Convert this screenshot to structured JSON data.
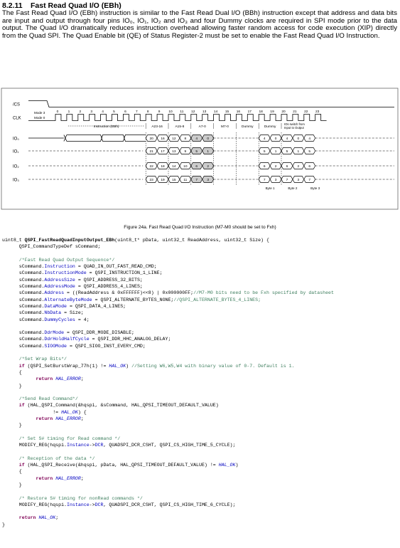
{
  "section": {
    "number": "8.2.11",
    "title": "Fast Read Quad I/O (EBh)"
  },
  "paragraph": "The Fast Read Quad I/O (EBh) instruction is similar to the Fast Read Dual I/O (BBh) instruction except that address and data bits are input and output through four pins IO₀, IO₁, IO₂ and IO₃ and four Dummy clocks are required in SPI mode prior to the data output. The Quad I/O dramatically reduces instruction overhead allowing faster random access for code execution (XIP) directly from the Quad SPI. The Quad Enable bit (QE) of Status Register-2 must be set to enable the Fast Read Quad I/O Instruction.",
  "diagram": {
    "signals": [
      "/CS",
      "CLK",
      "IO₀",
      "IO₁",
      "IO₂",
      "IO₃"
    ],
    "mode_labels": [
      "Mode 3",
      "Mode 0"
    ],
    "clock_numbers": [
      "0",
      "1",
      "2",
      "3",
      "4",
      "5",
      "6",
      "7",
      "8",
      "9",
      "10",
      "11",
      "12",
      "13",
      "14",
      "15",
      "16",
      "17",
      "18",
      "19",
      "20",
      "21",
      "22",
      "23"
    ],
    "phases": [
      "Instruction (EBh)",
      "A23-16",
      "A15-8",
      "A7-0",
      "M7-0",
      "Dummy",
      "Dummy"
    ],
    "switch_note_line1": "IOs switch from",
    "switch_note_line2": "Input to Output",
    "bytes": [
      "Byte 1",
      "Byte 2",
      "Byte 3"
    ],
    "io_bits": [
      [
        "20",
        "16",
        "12",
        "8",
        "4",
        "0"
      ],
      [
        "21",
        "17",
        "13",
        "9",
        "5",
        "1"
      ],
      [
        "22",
        "18",
        "14",
        "10",
        "6",
        "2"
      ],
      [
        "23",
        "19",
        "15",
        "11",
        "7",
        "3"
      ]
    ],
    "io_data": [
      [
        "4",
        "0",
        "4",
        "0",
        "4"
      ],
      [
        "5",
        "1",
        "5",
        "1",
        "5"
      ],
      [
        "6",
        "2",
        "6",
        "2",
        "6"
      ],
      [
        "7",
        "3",
        "7",
        "3",
        "7"
      ]
    ]
  },
  "caption": "Figure 24a. Fast Read Quad I/O Instruction (M7-M0 should be set to Fxh)",
  "code": [
    [
      [
        "t",
        "uint8_t "
      ],
      [
        "b",
        "QSPI_FastReadQuadInputOutput_EBh"
      ],
      [
        "t",
        "(uint8_t* pData, uint32_t ReadAddress, uint32_t Size) {"
      ]
    ],
    [
      [
        "t",
        "      QSPI_CommandTypeDef sCommand;"
      ]
    ],
    [],
    [
      [
        "t",
        "      "
      ],
      [
        "c",
        "/*Fast Read Quad Output Sequence*/"
      ]
    ],
    [
      [
        "t",
        "      sCommand."
      ],
      [
        "f",
        "Instruction"
      ],
      [
        "t",
        " = QUAD_IN_OUT_FAST_READ_CMD;"
      ]
    ],
    [
      [
        "t",
        "      sCommand."
      ],
      [
        "f",
        "InstructionMode"
      ],
      [
        "t",
        " = QSPI_INSTRUCTION_1_LINE;"
      ]
    ],
    [
      [
        "t",
        "      sCommand."
      ],
      [
        "f",
        "AddressSize"
      ],
      [
        "t",
        " = QSPI_ADDRESS_32_BITS;"
      ]
    ],
    [
      [
        "t",
        "      sCommand."
      ],
      [
        "f",
        "AddressMode"
      ],
      [
        "t",
        " = QSPI_ADDRESS_4_LINES;"
      ]
    ],
    [
      [
        "t",
        "      sCommand."
      ],
      [
        "f",
        "Address"
      ],
      [
        "t",
        " = ((ReadAddress & 0xFFFFFF)<<8) | 0x000000FF;"
      ],
      [
        "c",
        "//M7-M0 bits need to be Fxh specified by datasheet"
      ]
    ],
    [
      [
        "t",
        "      sCommand."
      ],
      [
        "f",
        "AlternateByteMode"
      ],
      [
        "t",
        " = QSPI_ALTERNATE_BYTES_NONE;"
      ],
      [
        "c",
        "//QSPI_ALTERNATE_BYTES_4_LINES;"
      ]
    ],
    [
      [
        "t",
        "      sCommand."
      ],
      [
        "f",
        "DataMode"
      ],
      [
        "t",
        " = QSPI_DATA_4_LINES;"
      ]
    ],
    [
      [
        "t",
        "      sCommand."
      ],
      [
        "f",
        "NbData"
      ],
      [
        "t",
        " = Size;"
      ]
    ],
    [
      [
        "t",
        "      sCommand."
      ],
      [
        "f",
        "DummyCycles"
      ],
      [
        "t",
        " = 4;"
      ]
    ],
    [],
    [
      [
        "t",
        "      sCommand."
      ],
      [
        "f",
        "DdrMode"
      ],
      [
        "t",
        " = QSPI_DDR_MODE_DISABLE;"
      ]
    ],
    [
      [
        "t",
        "      sCommand."
      ],
      [
        "f",
        "DdrHoldHalfCycle"
      ],
      [
        "t",
        " = QSPI_DDR_HHC_ANALOG_DELAY;"
      ]
    ],
    [
      [
        "t",
        "      sCommand."
      ],
      [
        "f",
        "SIOOMode"
      ],
      [
        "t",
        " = QSPI_SIOO_INST_EVERY_CMD;"
      ]
    ],
    [],
    [
      [
        "t",
        "      "
      ],
      [
        "c",
        "/*Set Wrap Bits*/"
      ]
    ],
    [
      [
        "t",
        "      "
      ],
      [
        "k",
        "if"
      ],
      [
        "t",
        " (QSPI_SetBurstWrap_77h(1) != "
      ],
      [
        "i",
        "HAL_OK"
      ],
      [
        "t",
        ") "
      ],
      [
        "c",
        "//Setting W6,W5,W4 with binary value of 0-7. Default is 1."
      ]
    ],
    [
      [
        "t",
        "      {"
      ]
    ],
    [
      [
        "t",
        "            "
      ],
      [
        "k",
        "return"
      ],
      [
        "t",
        " "
      ],
      [
        "i",
        "HAL_ERROR"
      ],
      [
        "t",
        ";"
      ]
    ],
    [
      [
        "t",
        "      }"
      ]
    ],
    [],
    [
      [
        "t",
        "      "
      ],
      [
        "c",
        "/*Send Read Command*/"
      ]
    ],
    [
      [
        "t",
        "      "
      ],
      [
        "k",
        "if"
      ],
      [
        "t",
        " (HAL_QSPI_Command(&hqspi, &sCommand, HAL_QPSI_TIMEOUT_DEFAULT_VALUE)"
      ]
    ],
    [
      [
        "t",
        "                  != "
      ],
      [
        "i",
        "HAL_OK"
      ],
      [
        "t",
        ") {"
      ]
    ],
    [
      [
        "t",
        "            "
      ],
      [
        "k",
        "return"
      ],
      [
        "t",
        " "
      ],
      [
        "i",
        "HAL_ERROR"
      ],
      [
        "t",
        ";"
      ]
    ],
    [
      [
        "t",
        "      }"
      ]
    ],
    [],
    [
      [
        "t",
        "      "
      ],
      [
        "c",
        "/* Set S# timing for Read command */"
      ]
    ],
    [
      [
        "t",
        "      MODIFY_REG(hqspi."
      ],
      [
        "f",
        "Instance"
      ],
      [
        "t",
        "->"
      ],
      [
        "f",
        "DCR"
      ],
      [
        "t",
        ", QUADSPI_DCR_CSHT, QSPI_CS_HIGH_TIME_5_CYCLE);"
      ]
    ],
    [],
    [
      [
        "t",
        "      "
      ],
      [
        "c",
        "/* Reception of the data */"
      ]
    ],
    [
      [
        "t",
        "      "
      ],
      [
        "k",
        "if"
      ],
      [
        "t",
        " (HAL_QSPI_Receive(&hqspi, pData, HAL_QPSI_TIMEOUT_DEFAULT_VALUE) != "
      ],
      [
        "i",
        "HAL_OK"
      ],
      [
        "t",
        ")"
      ]
    ],
    [
      [
        "t",
        "      {"
      ]
    ],
    [
      [
        "t",
        "            "
      ],
      [
        "k",
        "return"
      ],
      [
        "t",
        " "
      ],
      [
        "i",
        "HAL_ERROR"
      ],
      [
        "t",
        ";"
      ]
    ],
    [
      [
        "t",
        "      }"
      ]
    ],
    [],
    [
      [
        "t",
        "      "
      ],
      [
        "c",
        "/* Restore S# timing for nonRead commands */"
      ]
    ],
    [
      [
        "t",
        "      MODIFY_REG(hqspi."
      ],
      [
        "f",
        "Instance"
      ],
      [
        "t",
        "->"
      ],
      [
        "f",
        "DCR"
      ],
      [
        "t",
        ", QUADSPI_DCR_CSHT, QSPI_CS_HIGH_TIME_6_CYCLE);"
      ]
    ],
    [],
    [
      [
        "t",
        "      "
      ],
      [
        "k",
        "return"
      ],
      [
        "t",
        " "
      ],
      [
        "i",
        "HAL_OK"
      ],
      [
        "t",
        ";"
      ]
    ],
    [
      [
        "t",
        "}"
      ]
    ]
  ]
}
